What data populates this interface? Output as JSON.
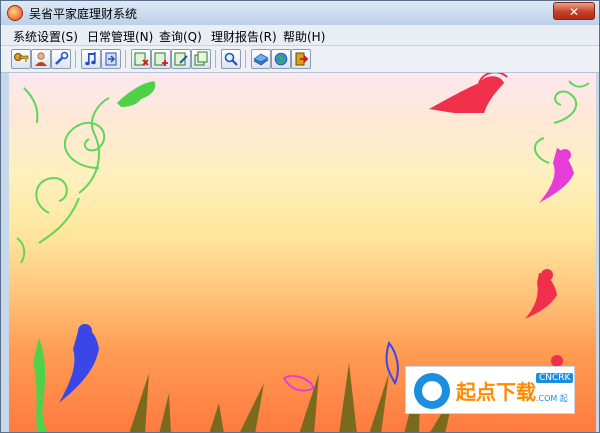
{
  "window": {
    "title": "吴省平家庭理财系统",
    "close_glyph": "✕"
  },
  "menu": {
    "items": [
      "系统设置(S)",
      "日常管理(N)",
      "查询(Q)",
      "理财报告(R)",
      "帮助(H)"
    ]
  },
  "toolbar": {
    "buttons": [
      "key-icon",
      "user-icon",
      "wrench-icon",
      "music-note-icon",
      "login-icon",
      "ledger-delete-icon",
      "ledger-add-icon",
      "ledger-edit-icon",
      "copy-icon",
      "search-icon",
      "books-icon",
      "globe-icon",
      "exit-icon"
    ]
  },
  "watermark": {
    "text": "起点下载",
    "badge": "CNCRK",
    "sub": ".COM 起"
  },
  "colors": {
    "fairy_red": "#f0304a",
    "fairy_magenta": "#e63cd8",
    "fairy_blue": "#3b46e6",
    "vine_green": "#4fd14a",
    "grass": "#7a6a1e"
  }
}
